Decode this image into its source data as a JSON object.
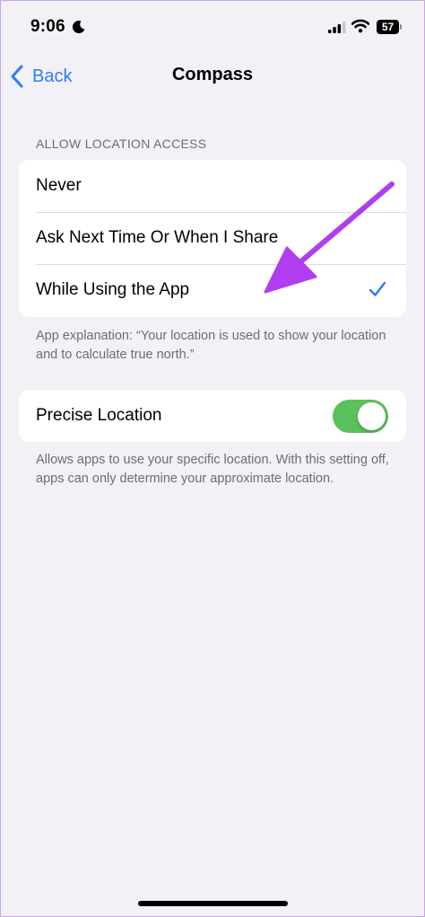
{
  "status_bar": {
    "time": "9:06",
    "battery": "57",
    "icons": [
      "moon-icon",
      "signal-icon",
      "wifi-icon",
      "battery-icon"
    ]
  },
  "nav": {
    "back_label": "Back",
    "title": "Compass",
    "back_icon": "chevron-left-icon"
  },
  "location_access": {
    "header": "ALLOW LOCATION ACCESS",
    "options": [
      {
        "label": "Never",
        "selected": false
      },
      {
        "label": "Ask Next Time Or When I Share",
        "selected": false
      },
      {
        "label": "While Using the App",
        "selected": true
      }
    ],
    "explanation": "App explanation: “Your location is used to show your location and to calculate true north.”"
  },
  "precise_location": {
    "label": "Precise Location",
    "enabled": true,
    "note": "Allows apps to use your specific location. With this setting off, apps can only determine your approximate location."
  },
  "colors": {
    "accent": "#2f7bf5",
    "toggle_on": "#5ac15b",
    "background": "#f2f1f6",
    "annotation_arrow": "#b03ef0"
  }
}
